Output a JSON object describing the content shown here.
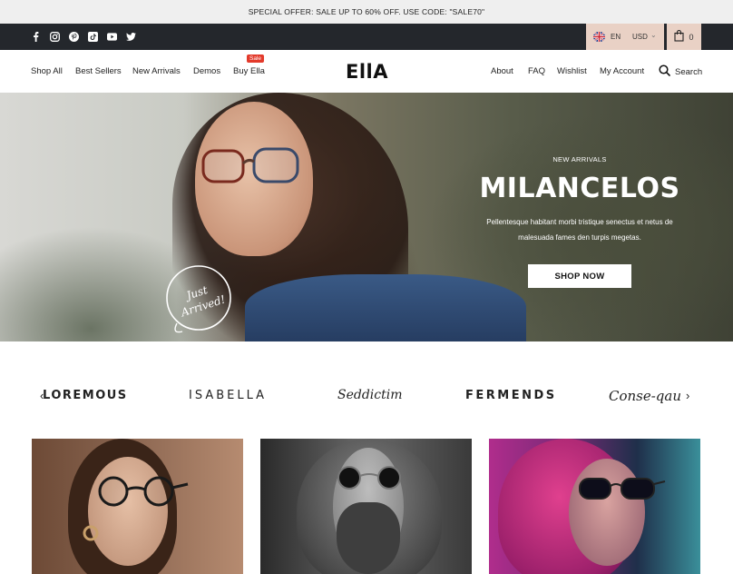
{
  "announcement": "SPECIAL OFFER: SALE UP TO 60% OFF. USE CODE: \"SALE70\"",
  "social_icons": [
    "facebook-icon",
    "instagram-icon",
    "pinterest-icon",
    "tiktok-icon",
    "youtube-icon",
    "twitter-icon"
  ],
  "locale": {
    "language": "EN",
    "currency": "USD"
  },
  "cart": {
    "count": "0"
  },
  "nav": {
    "left": [
      "Shop All",
      "Best Sellers",
      "New Arrivals",
      "Demos",
      "Buy Ella"
    ],
    "sale_badge": "Sale",
    "logo": "EllA",
    "right": [
      "About",
      "FAQ",
      "Wishlist",
      "My Account"
    ],
    "search_label": "Search"
  },
  "hero": {
    "eyebrow": "NEW ARRIVALS",
    "title": "MILANCELOS",
    "description": "Pellentesque habitant morbi tristique senectus et netus de malesuada fames den turpis megetas.",
    "button": "SHOP NOW",
    "stamp": "Just Arrived!"
  },
  "brands": [
    "LOREMOUS",
    "ISABELLA",
    "Seddictim",
    "FERMENDS",
    "Conse-qau"
  ],
  "colors": {
    "announcement_bg": "#efefef",
    "topbar_bg": "#24272c",
    "locale_bg": "#e9d1c5",
    "sale_badge": "#e33a2b"
  }
}
